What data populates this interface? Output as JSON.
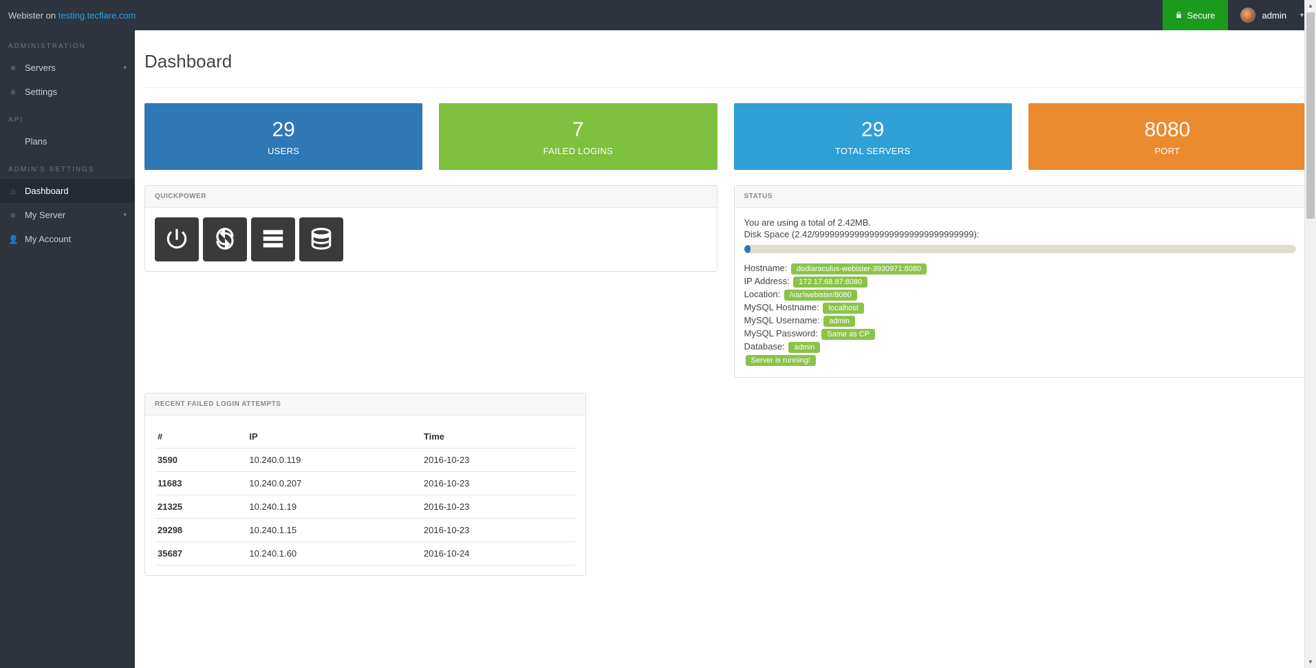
{
  "topbar": {
    "brand_prefix": "Webister on ",
    "brand_link": "testing.tecflare.com",
    "secure_label": "Secure",
    "user_label": "admin"
  },
  "sidebar": {
    "sections": [
      {
        "title": "ADMINISTRATION",
        "items": [
          {
            "name": "servers",
            "label": "Servers",
            "icon": "≡",
            "expandable": true
          },
          {
            "name": "settings",
            "label": "Settings",
            "icon": "≡",
            "expandable": false
          }
        ]
      },
      {
        "title": "API",
        "items": [
          {
            "name": "plans",
            "label": "Plans",
            "icon": "",
            "expandable": false
          }
        ]
      },
      {
        "title": "ADMIN'S SETTINGS",
        "items": [
          {
            "name": "dashboard",
            "label": "Dashboard",
            "icon": "⌂",
            "expandable": false,
            "active": true
          },
          {
            "name": "my-server",
            "label": "My Server",
            "icon": "≡",
            "expandable": true
          },
          {
            "name": "my-account",
            "label": "My Account",
            "icon": "👤",
            "expandable": false
          }
        ]
      }
    ]
  },
  "page": {
    "title": "Dashboard"
  },
  "stats": [
    {
      "value": "29",
      "label": "USERS",
      "color": "c-blue"
    },
    {
      "value": "7",
      "label": "FAILED LOGINS",
      "color": "c-green"
    },
    {
      "value": "29",
      "label": "TOTAL SERVERS",
      "color": "c-cyan"
    },
    {
      "value": "8080",
      "label": "PORT",
      "color": "c-orange"
    }
  ],
  "quickpower": {
    "title": "QUICKPOWER",
    "buttons": [
      {
        "name": "power"
      },
      {
        "name": "restart"
      },
      {
        "name": "server"
      },
      {
        "name": "database"
      }
    ]
  },
  "status": {
    "title": "STATUS",
    "usage_line": "You are using a total of 2.42MB.",
    "disk_line": "Disk Space (2.42/99999999999999999999999999999999):",
    "kv": [
      {
        "label": "Hostname:",
        "value": "dodiaraculus-webister-3930971:8080"
      },
      {
        "label": "IP Address:",
        "value": "172.17.68.87:8080"
      },
      {
        "label": "Location:",
        "value": "/var/webister/8080"
      },
      {
        "label": "MySQL Hostname:",
        "value": "localhost"
      },
      {
        "label": "MySQL Username:",
        "value": "admin"
      },
      {
        "label": "MySQL Password:",
        "value": "Same as CP"
      },
      {
        "label": "Database:",
        "value": "admin"
      }
    ],
    "running_badge": "Server is running!"
  },
  "failed_logins": {
    "title": "RECENT FAILED LOGIN ATTEMPTS",
    "headers": [
      "#",
      "IP",
      "Time"
    ],
    "rows": [
      {
        "id": "3590",
        "ip": "10.240.0.119",
        "time": "2016-10-23"
      },
      {
        "id": "11683",
        "ip": "10.240.0.207",
        "time": "2016-10-23"
      },
      {
        "id": "21325",
        "ip": "10.240.1.19",
        "time": "2016-10-23"
      },
      {
        "id": "29298",
        "ip": "10.240.1.15",
        "time": "2016-10-23"
      },
      {
        "id": "35687",
        "ip": "10.240.1.60",
        "time": "2016-10-24"
      }
    ]
  }
}
